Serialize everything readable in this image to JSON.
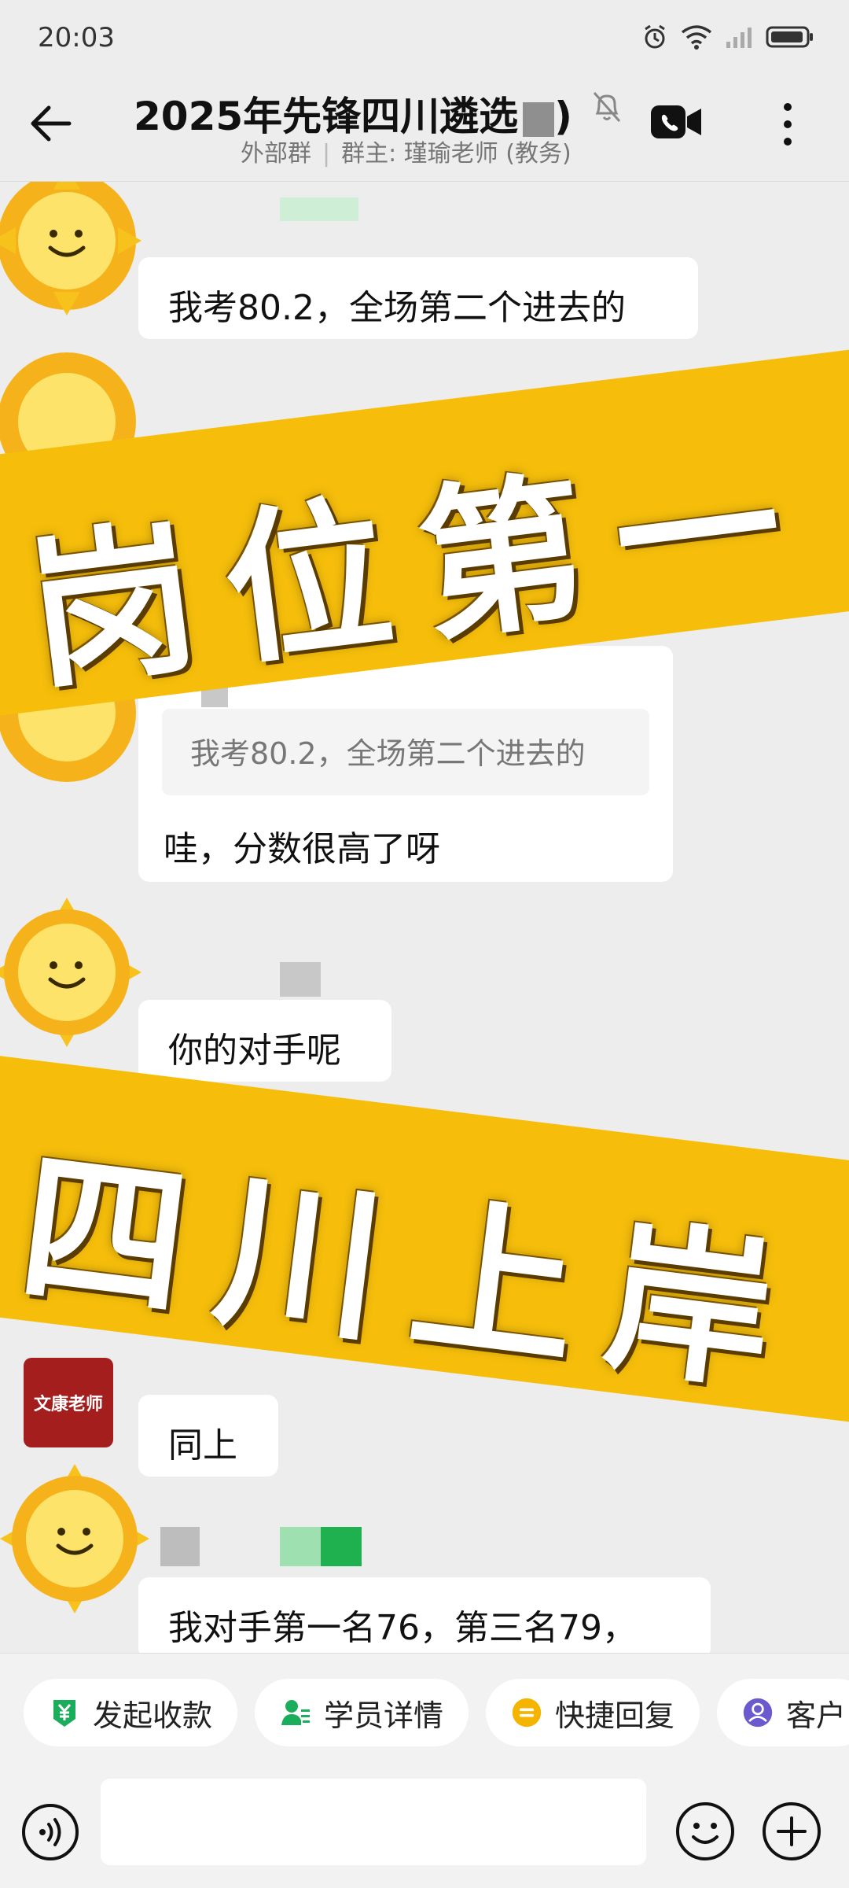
{
  "status": {
    "time": "20:03"
  },
  "header": {
    "title": "2025年先锋四川遴选",
    "title_suffix": ")",
    "subtitle_type": "外部群",
    "subtitle_owner": "群主: 瑾瑜老师 (教务)"
  },
  "messages": {
    "m1": "我考80.2，全场第二个进去的",
    "m2_quote": "我考80.2，全场第二个进去的",
    "m2": "哇，分数很高了呀",
    "m3": "你的对手呢",
    "m4": "同上",
    "m5": "我对手第一名76，第三名79，"
  },
  "banners": {
    "top": "岗位第一",
    "bottom": "四川上岸"
  },
  "teacher_avatar_text": "文康老师",
  "actions": [
    {
      "label": "发起收款",
      "icon": "yuan-icon",
      "color": "#1AAD5B"
    },
    {
      "label": "学员详情",
      "icon": "student-icon",
      "color": "#1AAD5B"
    },
    {
      "label": "快捷回复",
      "icon": "quick-reply-icon",
      "color": "#F5B400"
    },
    {
      "label": "客户",
      "icon": "customer-icon",
      "color": "#6A5ACD"
    }
  ],
  "colors": {
    "banner": "#F6BE0B",
    "background": "#EDEDED",
    "bubble": "#FFFFFF",
    "green": "#1AAD5B"
  }
}
